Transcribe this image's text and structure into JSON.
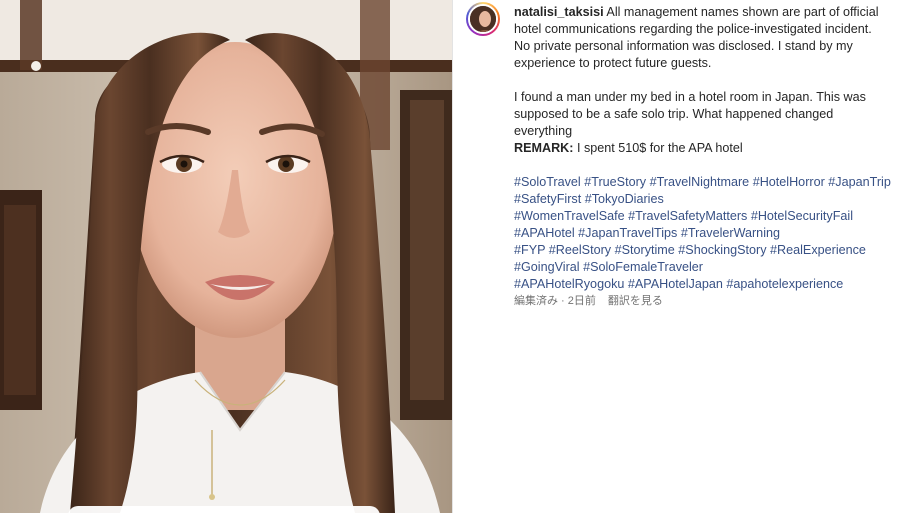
{
  "post": {
    "username": "natalisi_taksisi",
    "caption_lines": [
      "All management names shown are part of official",
      "hotel communications regarding the police-investigated incident.",
      "No private personal information was disclosed. I stand by my",
      "experience to protect future guests."
    ],
    "story_lines": [
      "I found a man under my bed in a hotel room in Japan. This was",
      "supposed to be a safe solo trip. What happened changed",
      "everything"
    ],
    "remark_label": "REMARK:",
    "remark_text": " I spent 510$ for the APA hotel",
    "hashtag_lines": [
      [
        "#SoloTravel",
        "#TrueStory",
        "#TravelNightmare",
        "#HotelHorror",
        "#JapanTrip"
      ],
      [
        "#SafetyFirst",
        "#TokyoDiaries"
      ],
      [
        "#WomenTravelSafe",
        "#TravelSafetyMatters",
        "#HotelSecurityFail"
      ],
      [
        "#APAHotel",
        "#JapanTravelTips",
        "#TravelerWarning"
      ],
      [
        "#FYP",
        "#ReelStory",
        "#Storytime",
        "#ShockingStory",
        "#RealExperience"
      ],
      [
        "#GoingViral",
        "#SoloFemaleTraveler"
      ],
      [
        "#APAHotelRyogoku",
        "#APAHotelJapan",
        "#apahotelexperience"
      ]
    ],
    "meta": {
      "edited_time": "編集済み · 2日前",
      "translate": "翻訳を見る"
    }
  },
  "colors": {
    "hashtag": "#385185",
    "text": "#262626",
    "meta": "#737373"
  }
}
